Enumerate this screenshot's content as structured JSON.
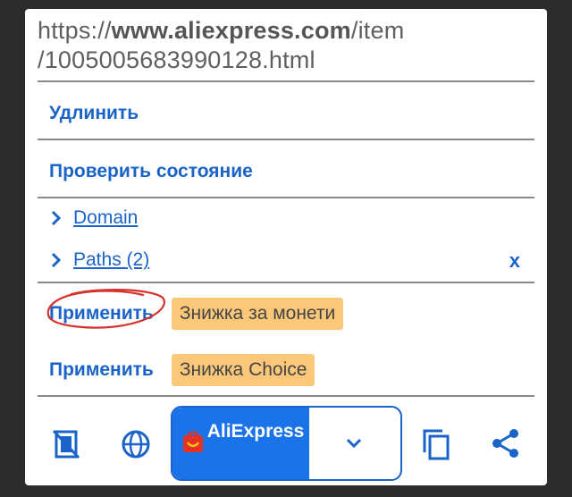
{
  "url": {
    "prefix": "https://",
    "domain": "www.aliexpress.com",
    "path_line1": "/item",
    "path_line2": "/1005005683990128.html"
  },
  "actions": {
    "lengthen": "Удлинить",
    "check_status": "Проверить состояние"
  },
  "tree": {
    "domain_label": "Domain",
    "paths_label": "Paths (2)",
    "close": "x"
  },
  "applies": [
    {
      "label": "Применить",
      "badge": "Знижка за монети",
      "circled": true
    },
    {
      "label": "Применить",
      "badge": "Знижка Choice",
      "circled": false
    }
  ],
  "toolbar": {
    "app_name": "AliExpress",
    "icons": [
      "disable-media-icon",
      "globe-icon",
      "aliexpress-logo-icon",
      "chevron-down-icon",
      "copy-icon",
      "share-icon"
    ]
  },
  "colors": {
    "link_blue": "#1a63c8",
    "badge_bg": "#fbc87a",
    "app_button_bg": "#1a73e8",
    "annotation_red": "#d6312b"
  }
}
